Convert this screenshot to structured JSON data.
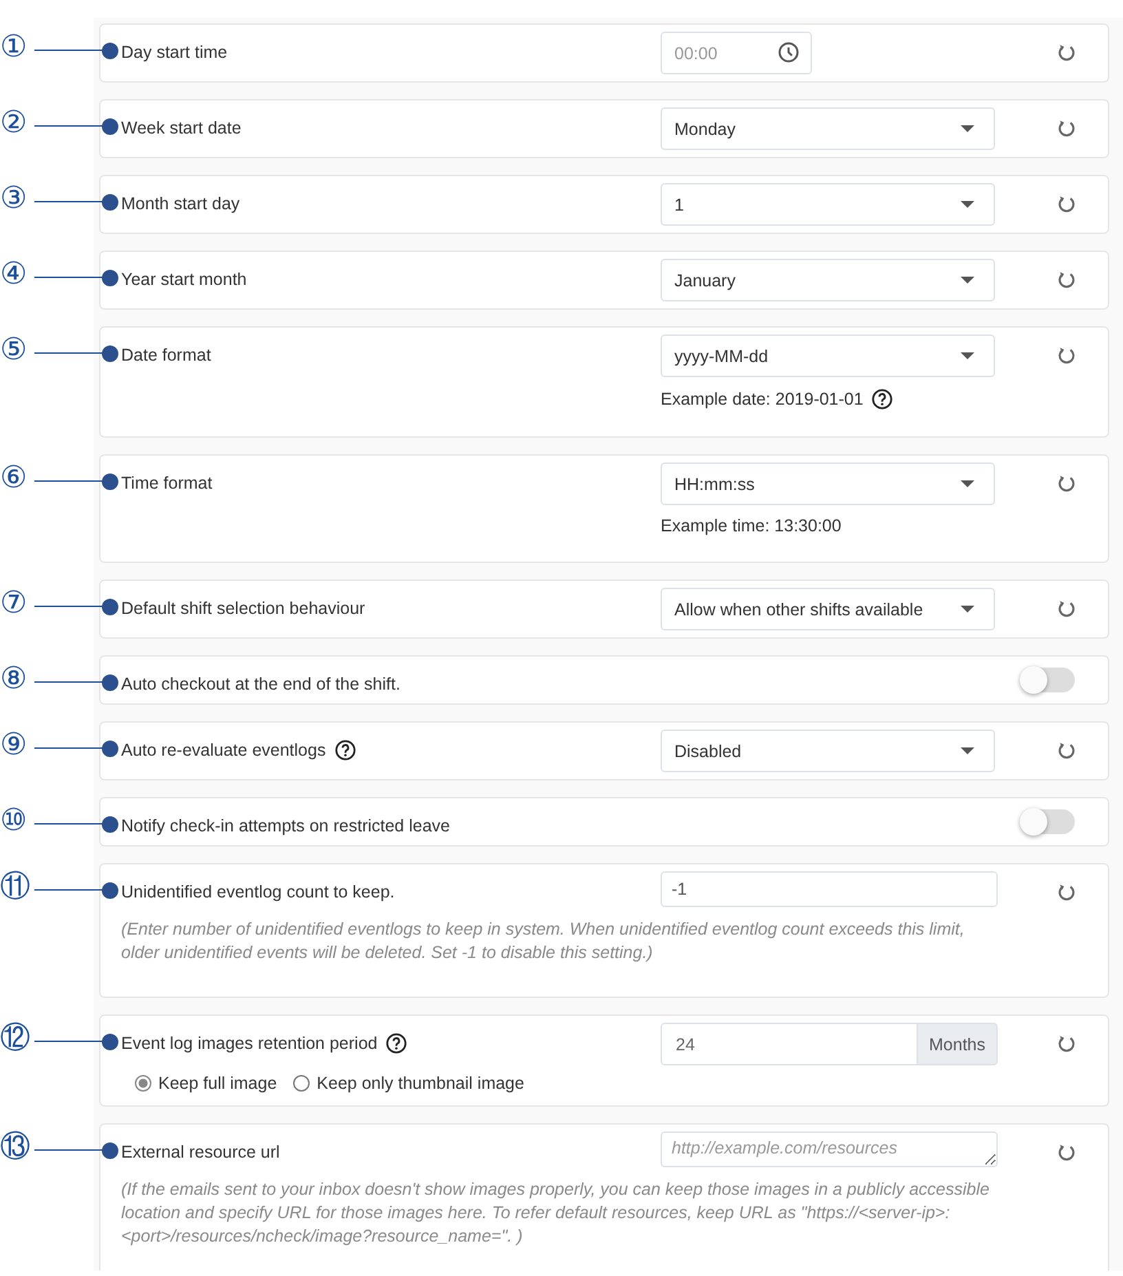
{
  "settings": [
    {
      "marker": "①",
      "label": "Day start time",
      "kind": "time",
      "placeholder": "00:00"
    },
    {
      "marker": "②",
      "label": "Week start date",
      "kind": "select",
      "value": "Monday"
    },
    {
      "marker": "③",
      "label": "Month start day",
      "kind": "select",
      "value": "1"
    },
    {
      "marker": "④",
      "label": "Year start month",
      "kind": "select",
      "value": "January"
    },
    {
      "marker": "⑤",
      "label": "Date format",
      "kind": "select",
      "value": "yyyy-MM-dd",
      "example": "Example date: 2019-01-01",
      "example_help": true
    },
    {
      "marker": "⑥",
      "label": "Time format",
      "kind": "select",
      "value": "HH:mm:ss",
      "example": "Example time: 13:30:00"
    },
    {
      "marker": "⑦",
      "label": "Default shift selection behaviour",
      "kind": "select",
      "value": "Allow when other shifts available"
    },
    {
      "marker": "⑧",
      "label": "Auto checkout at the end of the shift.",
      "kind": "toggle",
      "on": false
    },
    {
      "marker": "⑨",
      "label": "Auto re-evaluate eventlogs",
      "label_help": true,
      "kind": "select",
      "value": "Disabled"
    },
    {
      "marker": "⑩",
      "label": "Notify check-in attempts on restricted leave",
      "kind": "toggle",
      "on": false
    },
    {
      "marker": "⑪",
      "label": "Unidentified eventlog count to keep.",
      "kind": "text",
      "value": "-1",
      "hint": "(Enter number of unidentified eventlogs to keep in system. When unidentified eventlog count exceeds this limit, older unidentified events will be deleted. Set -1 to disable this setting.)"
    },
    {
      "marker": "⑫",
      "label": "Event log images retention period",
      "label_help": true,
      "kind": "number",
      "value": "24",
      "unit": "Months",
      "options": [
        {
          "label": "Keep full image",
          "selected": true
        },
        {
          "label": "Keep only thumbnail image",
          "selected": false
        }
      ]
    },
    {
      "marker": "⑬",
      "label": "External resource url",
      "kind": "url",
      "placeholder": "http://example.com/resources",
      "hint": "(If the emails sent to your inbox doesn't show images properly, you can keep those images in a publicly accessible location and specify URL for those images here. To refer default resources, keep URL as \"https://<server-ip>:<port>/resources/ncheck/image?resource_name=\". )"
    }
  ]
}
